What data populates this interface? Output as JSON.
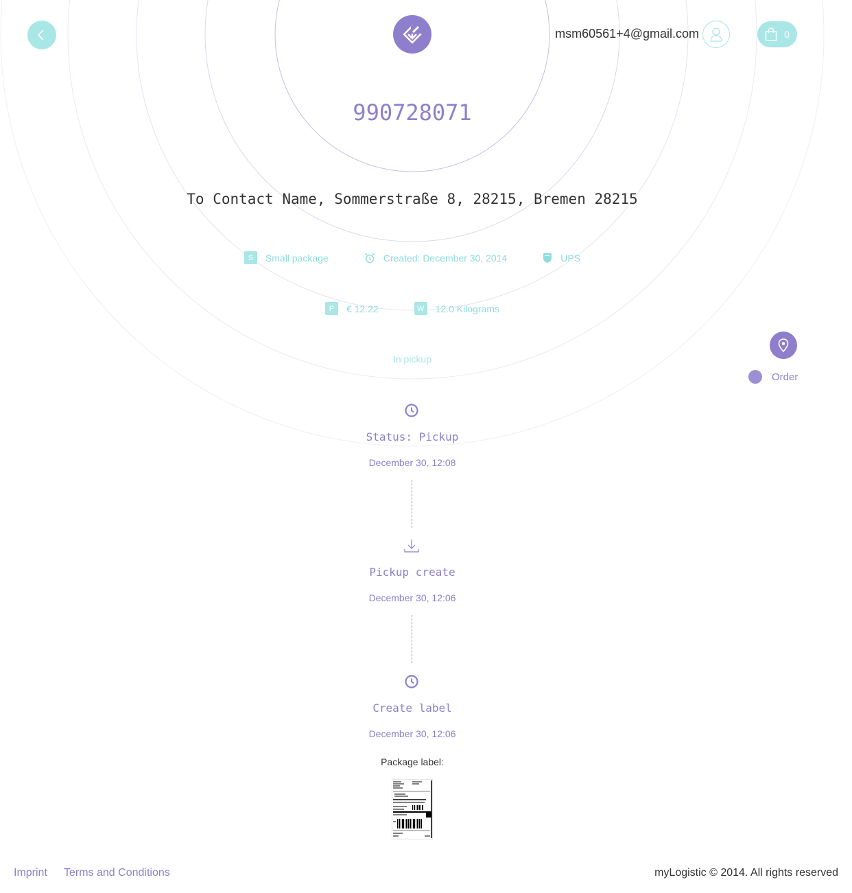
{
  "header": {
    "back_icon": "chevron-left-icon",
    "logo_icon": "download-diamond-logo-icon",
    "user_email": "msm60561+4@gmail.com",
    "user_icon": "user-icon",
    "cart_icon": "shopping-bag-icon",
    "cart_count": "0"
  },
  "shipment": {
    "tracking_number": "990728071",
    "address": "To Contact Name, Sommerstraße 8, 28215, Bremen 28215",
    "package_badge": "S",
    "package_type": "Small package",
    "created_icon": "alarm-clock-icon",
    "created": "Created: December 30, 2014",
    "carrier_icon": "ups-shield-icon",
    "carrier": "UPS",
    "price_badge": "P",
    "price": "€ 12.22",
    "weight_badge": "W",
    "weight": "12.0 Kilograms",
    "status": "In pickup"
  },
  "map_legend": {
    "pin_icon": "location-pin-icon",
    "label": "Order"
  },
  "timeline": [
    {
      "icon": "clock-icon",
      "title": "Status: Pickup",
      "date": "December 30, 12:08"
    },
    {
      "icon": "download-arrow-icon",
      "title": "Pickup create",
      "date": "December 30, 12:06"
    },
    {
      "icon": "clock-icon",
      "title": "Create label",
      "date": "December 30, 12:06"
    }
  ],
  "package_label": {
    "caption": "Package label:"
  },
  "footer": {
    "imprint": "Imprint",
    "terms": "Terms and Conditions",
    "copyright": "myLogistic © 2014. All rights reserved"
  },
  "colors": {
    "accent_purple": "#8e7fcc",
    "accent_teal": "#a9e6e6",
    "text_dark": "#333333"
  }
}
